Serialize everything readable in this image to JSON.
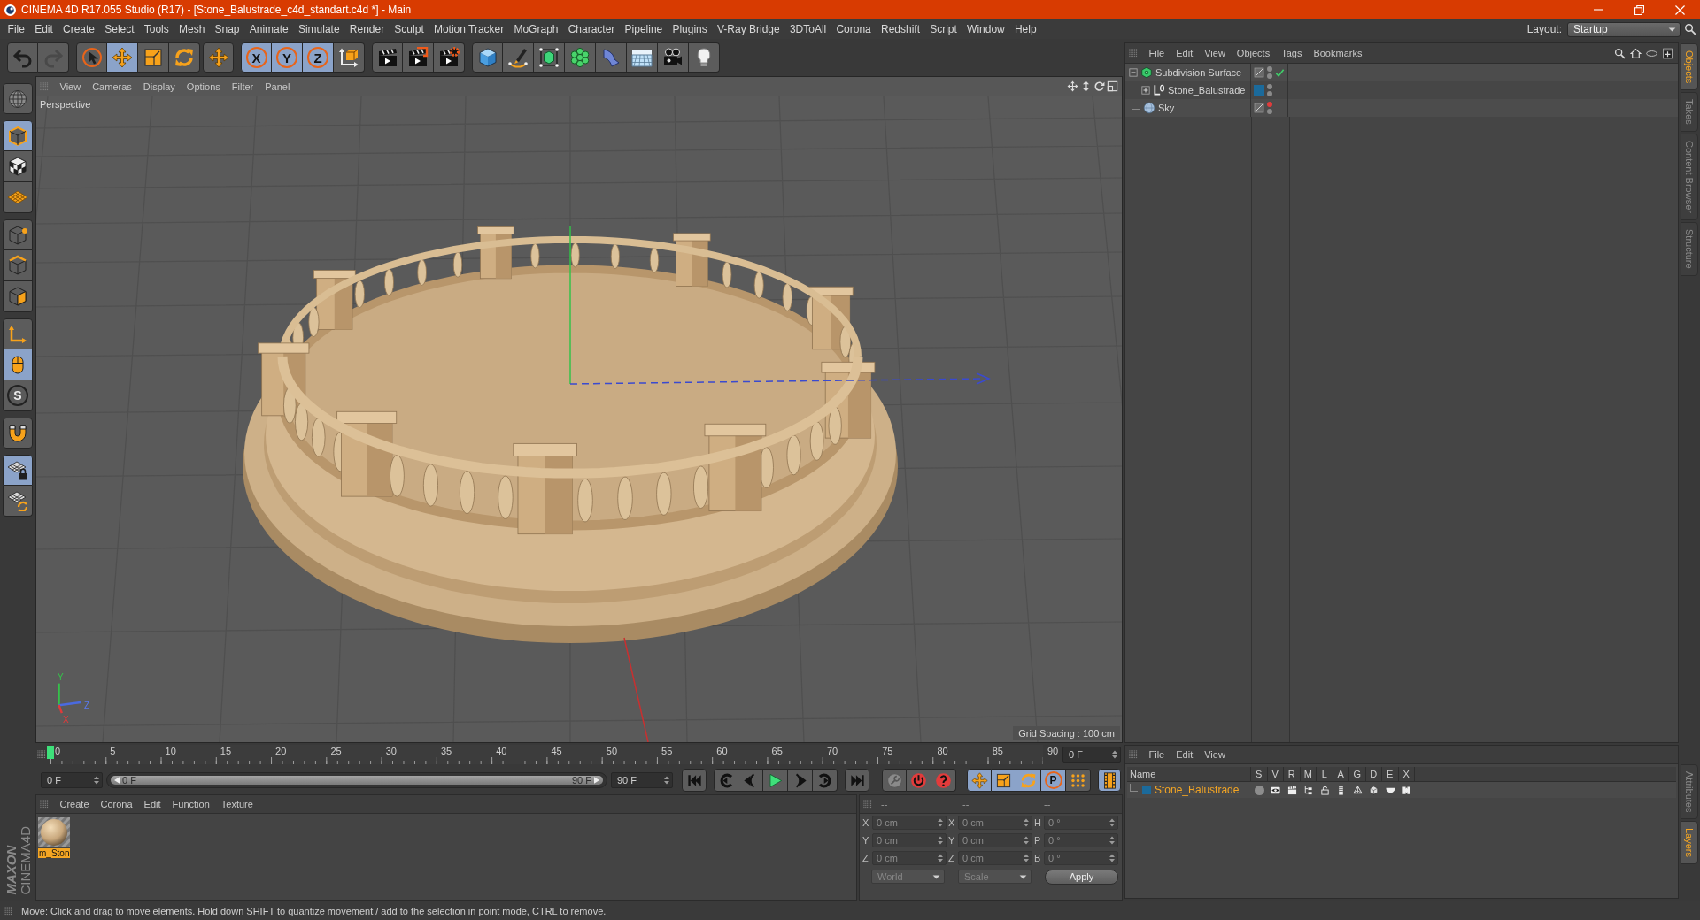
{
  "window": {
    "title": "CINEMA 4D R17.055 Studio (R17) - [Stone_Balustrade_c4d_standart.c4d *] - Main"
  },
  "menu": [
    "File",
    "Edit",
    "Create",
    "Select",
    "Tools",
    "Mesh",
    "Snap",
    "Animate",
    "Simulate",
    "Render",
    "Sculpt",
    "Motion Tracker",
    "MoGraph",
    "Character",
    "Pipeline",
    "Plugins",
    "V-Ray Bridge",
    "3DToAll",
    "Corona",
    "Redshift",
    "Script",
    "Window",
    "Help"
  ],
  "layout": {
    "label": "Layout:",
    "value": "Startup"
  },
  "toolbar": [
    [
      {
        "on": false,
        "disabled": false
      },
      {
        "on": false,
        "disabled": true
      }
    ],
    [
      {
        "on": false
      },
      {
        "on": true
      },
      {
        "on": false
      },
      {
        "on": false
      }
    ],
    [
      {
        "on": false
      }
    ],
    [
      {
        "on": true,
        "label": "X"
      },
      {
        "on": true,
        "label": "Y"
      },
      {
        "on": true,
        "label": "Z"
      },
      {
        "on": false
      }
    ],
    [
      {
        "on": false
      },
      {
        "on": false
      },
      {
        "on": false
      }
    ],
    [
      {
        "on": false
      },
      {
        "on": false
      },
      {
        "on": false
      },
      {
        "on": false
      },
      {
        "on": false
      },
      {
        "on": false
      },
      {
        "on": false
      },
      {
        "on": false
      }
    ]
  ],
  "mode_toolbar": [
    [
      {
        "on": false
      }
    ],
    [
      {
        "on": true
      },
      {
        "on": false
      },
      {
        "on": false
      }
    ],
    [
      {
        "on": false
      },
      {
        "on": false
      },
      {
        "on": false
      }
    ],
    [
      {
        "on": false
      },
      {
        "on": true
      },
      {
        "on": false,
        "label": "S"
      }
    ],
    [
      {
        "on": false
      }
    ],
    [
      {
        "on": true
      },
      {
        "on": false
      }
    ]
  ],
  "viewport": {
    "menu": [
      "View",
      "Cameras",
      "Display",
      "Options",
      "Filter",
      "Panel"
    ],
    "camera": "Perspective",
    "axis_labels": [
      "Y",
      "Z",
      "X"
    ],
    "grid_spacing": "Grid Spacing : 100 cm"
  },
  "timeline": {
    "ticks": [
      "0",
      "5",
      "10",
      "15",
      "20",
      "25",
      "30",
      "35",
      "40",
      "45",
      "50",
      "55",
      "60",
      "65",
      "70",
      "75",
      "80",
      "85",
      "90"
    ],
    "playhead": {
      "level": 0
    },
    "current_frame": "0 F",
    "start_frame": "0 F",
    "preview_range": {
      "start": "0 F",
      "end": "90 F",
      "level": 1
    },
    "end_frame": "90 F",
    "autokey": {
      "on": false
    },
    "key_buttons": [
      {
        "on": true
      },
      {
        "on": true
      },
      {
        "on": true
      },
      {
        "on": true,
        "label": "P"
      },
      {
        "on": false
      }
    ],
    "timeline_button": {
      "on": true
    }
  },
  "material_manager": {
    "menu": [
      "Create",
      "Corona",
      "Edit",
      "Function",
      "Texture"
    ],
    "materials": [
      {
        "name": "m_Ston",
        "selected": true
      }
    ]
  },
  "coordinates": {
    "headers": [
      "--",
      "--",
      "--"
    ],
    "disabled": true,
    "rows": [
      [
        {
          "label": "X",
          "value": "0 cm"
        },
        {
          "label": "X",
          "value": "0 cm"
        },
        {
          "label": "H",
          "value": "0 °"
        }
      ],
      [
        {
          "label": "Y",
          "value": "0 cm"
        },
        {
          "label": "Y",
          "value": "0 cm"
        },
        {
          "label": "P",
          "value": "0 °"
        }
      ],
      [
        {
          "label": "Z",
          "value": "0 cm"
        },
        {
          "label": "Z",
          "value": "0 cm"
        },
        {
          "label": "B",
          "value": "0 °"
        }
      ]
    ],
    "space": "World",
    "mode": "Scale",
    "apply": "Apply"
  },
  "objects_panel": {
    "menu": [
      "File",
      "Edit",
      "View",
      "Objects",
      "Tags",
      "Bookmarks"
    ],
    "objects": [
      {
        "name": "Subdivision Surface",
        "kind": "subdivision",
        "expanded": true,
        "selected": false,
        "editor_visible": true,
        "render_visible": true,
        "enabled": true,
        "children": [
          {
            "name": "Stone_Balustrade",
            "kind": "polygon",
            "expanded": false,
            "selected": false,
            "color": "#1b6a9b",
            "editor_visible": true,
            "render_visible": true
          }
        ]
      },
      {
        "name": "Sky",
        "kind": "sky",
        "selected": false,
        "editor_visible": false,
        "render_visible": true
      }
    ]
  },
  "layers_panel": {
    "menu": [
      "File",
      "Edit",
      "View"
    ],
    "columns": [
      "Name",
      "S",
      "V",
      "R",
      "M",
      "L",
      "A",
      "G",
      "D",
      "E",
      "X"
    ],
    "layers": [
      {
        "name": "Stone_Balustrade",
        "color": "#1b6a9b",
        "selected": true,
        "flags": [
          {
            "on": false
          },
          {
            "on": true
          },
          {
            "on": true
          },
          {
            "on": true
          },
          {
            "on": false
          },
          {
            "on": true
          },
          {
            "on": true
          },
          {
            "on": true
          },
          {
            "on": true
          },
          {
            "on": true
          }
        ]
      }
    ]
  },
  "side_tabs": {
    "top": [
      {
        "label": "Objects",
        "selected": true
      },
      {
        "label": "Takes",
        "selected": false
      },
      {
        "label": "Content Browser",
        "selected": false
      },
      {
        "label": "Structure",
        "selected": false
      }
    ],
    "bottom": [
      {
        "label": "Attributes",
        "selected": false
      },
      {
        "label": "Layers",
        "selected": true
      }
    ]
  },
  "logo": {
    "brand": "MAXON",
    "product": "CINEMA4D"
  },
  "status_bar": "Move: Click and drag to move elements. Hold down SHIFT to quantize movement / add to the selection in point mode, CTRL to remove."
}
